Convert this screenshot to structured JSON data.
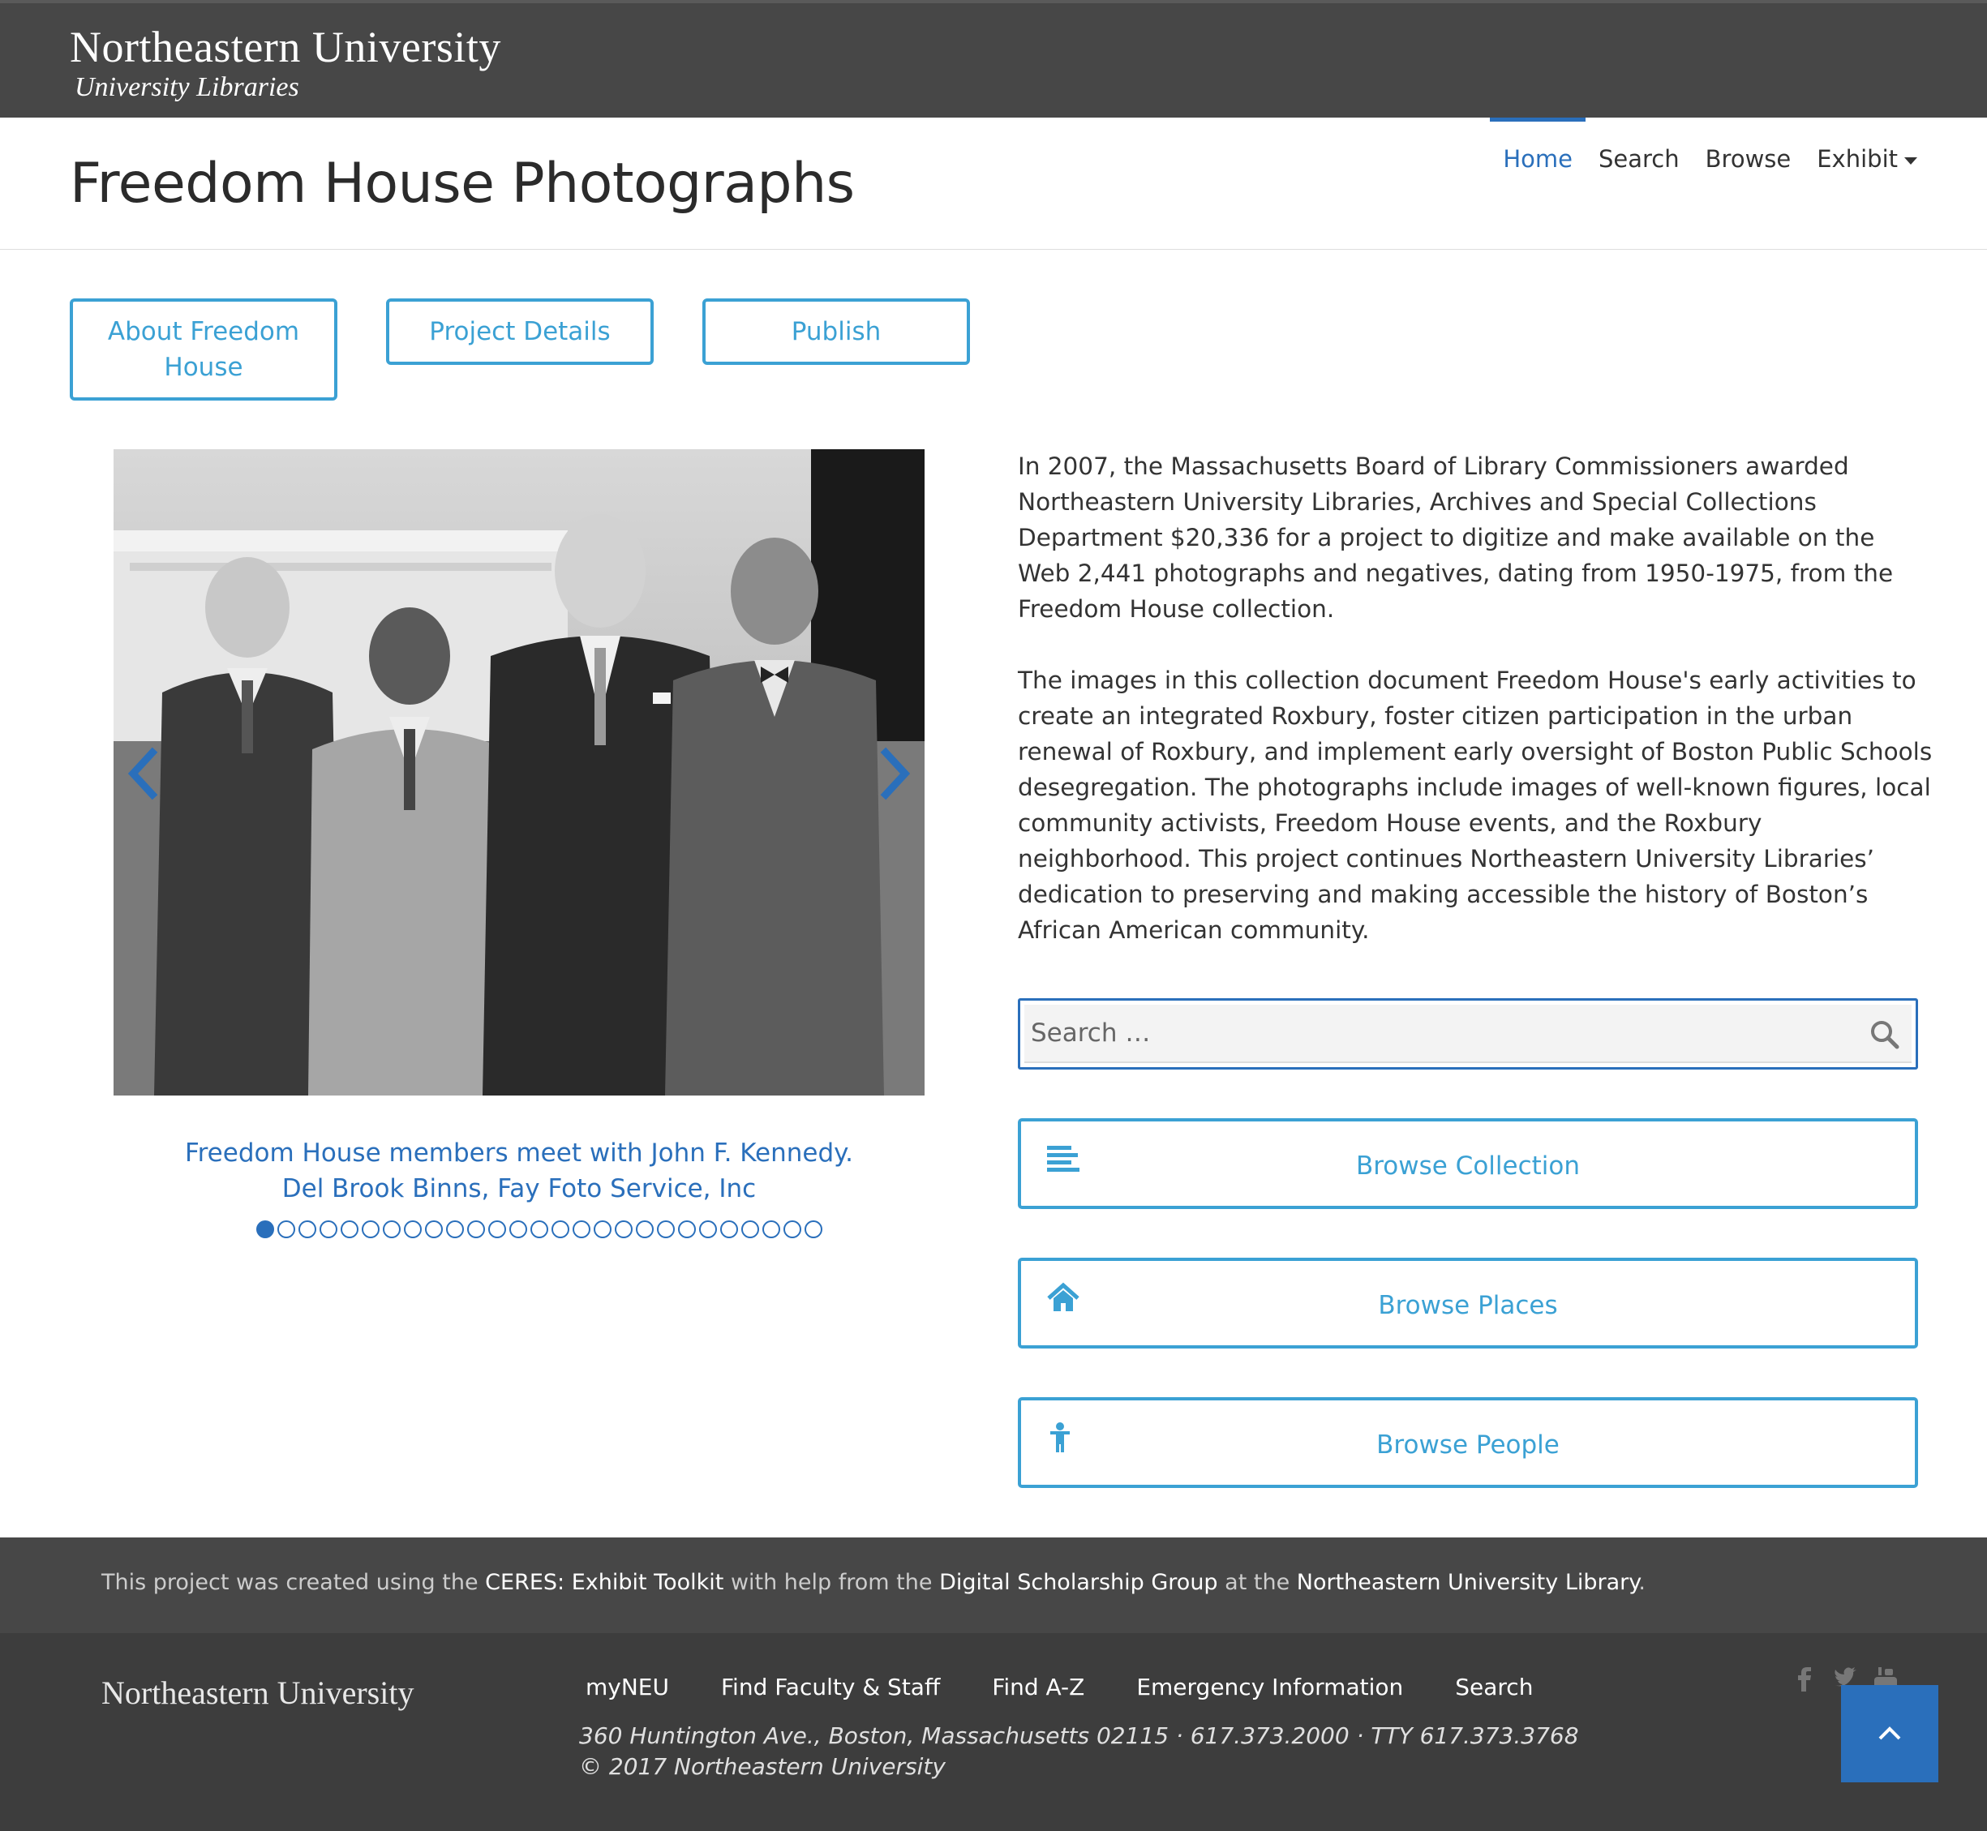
{
  "header": {
    "brand_name": "Northeastern University",
    "brand_sub": "University Libraries"
  },
  "title_bar": {
    "page_title": "Freedom House Photographs",
    "nav": [
      {
        "label": "Home",
        "active": true
      },
      {
        "label": "Search",
        "active": false
      },
      {
        "label": "Browse",
        "active": false
      },
      {
        "label": "Exhibit",
        "active": false
      }
    ]
  },
  "top_buttons": {
    "about_line1": "About Freedom",
    "about_line2": "House",
    "project": "Project Details",
    "publish": "Publish"
  },
  "carousel": {
    "caption_line1": "Freedom House members meet with John F. Kennedy.",
    "caption_line2": "Del Brook Binns, Fay Foto Service, Inc",
    "slide_count": 27,
    "active_slide": 1
  },
  "description": {
    "p1": "In 2007, the  Massachusetts Board  of Library Commissioners awarded Northeastern University Libraries, Archives and Special Collections Department $20,336  for a  project to digitize  and make available on the Web 2,441 photographs and negatives, dating from 1950-1975, from the Freedom House collection.",
    "p2": "The images in this collection document Freedom House's early activities to create an integrated Roxbury, foster citizen participation in the urban renewal of Roxbury, and implement early oversight of Boston Public  Schools desegregation. The photographs include images of well-known figures, local community activists, Freedom House  events, and the Roxbury neighborhood. This project  continues Northeastern University Libraries’ dedication to preserving and making accessible the history of Boston’s African American community."
  },
  "search": {
    "placeholder": "Search …"
  },
  "browse": {
    "collection": "Browse Collection",
    "places": "Browse Places",
    "people": "Browse People"
  },
  "credit": {
    "prefix": "This project was created using the ",
    "link1": "CERES: Exhibit Toolkit",
    "mid1": " with help from the ",
    "link2": "Digital Scholarship Group",
    "mid2": " at the ",
    "link3": "Northeastern University Library",
    "suffix": "."
  },
  "footer": {
    "brand": "Northeastern University",
    "links": [
      "myNEU",
      "Find Faculty & Staff",
      "Find A-Z",
      "Emergency Information",
      "Search"
    ],
    "address": "360 Huntington Ave., Boston, Massachusetts 02115 · 617.373.2000 · TTY 617.373.3768",
    "copyright": "© 2017 Northeastern University",
    "social": [
      "facebook-icon",
      "twitter-icon",
      "youtube-icon"
    ]
  },
  "colors": {
    "accent": "#2a6fbb",
    "button_border": "#3ba1d4",
    "header_bg": "#474747",
    "footer_bg": "#3d3d3d"
  }
}
